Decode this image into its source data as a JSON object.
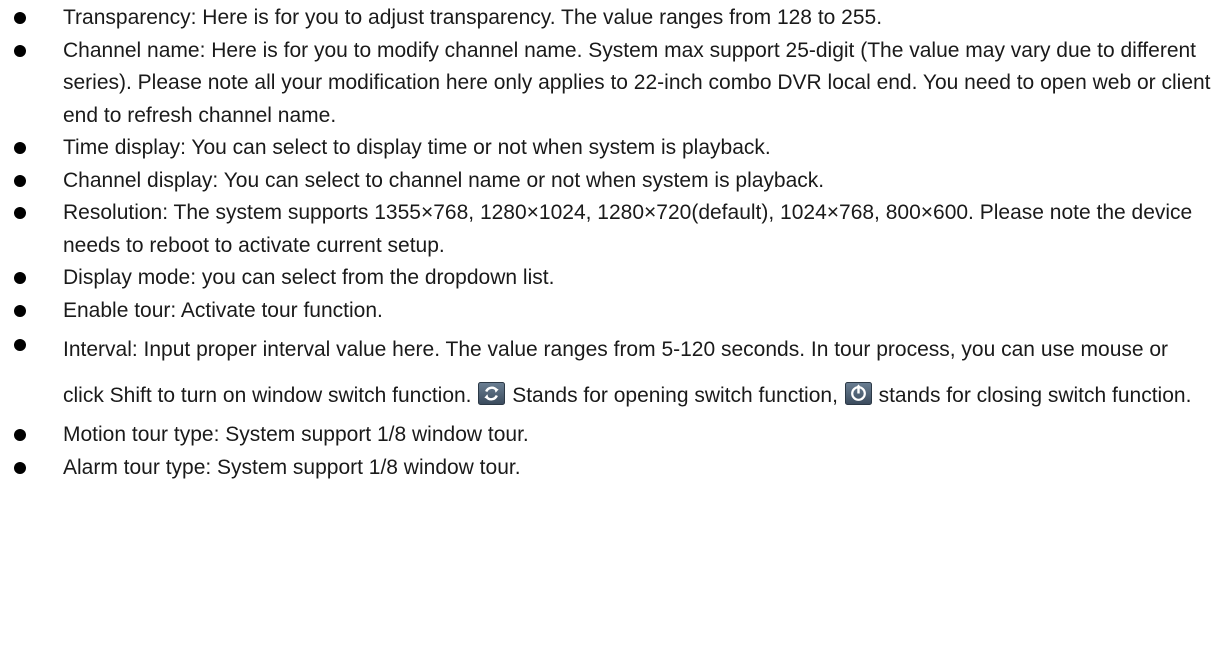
{
  "items": [
    {
      "text": "Transparency: Here is for you to adjust transparency. The value ranges from 128 to 255."
    },
    {
      "text": "Channel name: Here is for you to modify channel name. System max support 25-digit (The value may vary due to different series). Please note all your modification here only applies to 22-inch combo DVR local end. You need to open web or client end to refresh channel name."
    },
    {
      "text": "Time display: You can select to display time or not when system is playback."
    },
    {
      "text": "Channel display: You can select to channel name or not when system is playback."
    },
    {
      "text": "Resolution: The system supports 1355×768, 1280×1024, 1280×720(default), 1024×768, 800×600. Please note the device needs to reboot to activate current setup."
    },
    {
      "text": "Display mode: you can select from the dropdown list."
    },
    {
      "text": "Enable tour: Activate tour function."
    },
    {
      "text_part1": "Interval: Input proper interval value here. The value ranges from 5-120 seconds. In tour process, you can use mouse or click Shift to turn on window switch function.",
      "text_part2": "Stands for opening switch function,",
      "text_part3": "stands for closing switch function.",
      "icon_open": "switch-open-icon",
      "icon_close": "switch-close-icon"
    },
    {
      "text": "Motion tour type: System support 1/8 window tour."
    },
    {
      "text": "Alarm tour type: System support 1/8 window tour."
    }
  ]
}
